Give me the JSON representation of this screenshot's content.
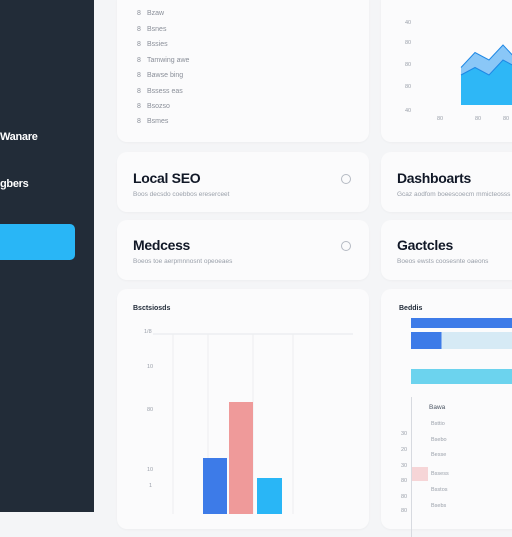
{
  "sidebar": {
    "items": [
      {
        "label": "Wanare"
      },
      {
        "label": "gbers"
      }
    ],
    "active_color": "#29b6f6"
  },
  "top_list": {
    "rows": [
      {
        "num": "8",
        "label": "Bzaw"
      },
      {
        "num": "8",
        "label": "Bsnes"
      },
      {
        "num": "8",
        "label": "Bssies"
      },
      {
        "num": "8",
        "label": "Tamwing awe"
      },
      {
        "num": "8",
        "label": "Bawse bing"
      },
      {
        "num": "8",
        "label": "Bssess eas"
      },
      {
        "num": "8",
        "label": "Bsozso"
      },
      {
        "num": "8",
        "label": "Bsmes"
      }
    ]
  },
  "area_chart": {
    "y_ticks": [
      "40",
      "80",
      "80",
      "80",
      "40"
    ],
    "x_ticks": [
      "80",
      "80",
      "80"
    ],
    "colors": {
      "back": "#64b5f6",
      "front": "#29b6f6",
      "edge": "#1e88e5"
    }
  },
  "tiles": [
    {
      "title": "Local SEO",
      "subtitle": "Boos decsdo coebbos ereserceet"
    },
    {
      "title": "Dashboarts",
      "subtitle": "Gcaz aodfom boeescoecm mmicteosss"
    },
    {
      "title": "Medcess",
      "subtitle": "Boeos toe aerpmnnosnt opeoeaes"
    },
    {
      "title": "Gactcles",
      "subtitle": "Boeos ewsts coosesnte oaeons"
    }
  ],
  "bar_chart": {
    "title": "Bsctsiosds",
    "y_ticks": [
      "1/8",
      "10",
      "80",
      "10",
      "1"
    ],
    "colors": {
      "blue": "#3d7be8",
      "pink": "#ef9a9a",
      "light": "#29b6f6"
    }
  },
  "hbar_chart": {
    "title": "Beddis",
    "colors": {
      "blue": "#3d7be8",
      "pale": "#d6eaf5",
      "cyan": "#6cd3ee"
    },
    "legend_title": "Bawa",
    "legend_items": [
      "Bsttio",
      "Bsebo",
      "Besse",
      "Bssess",
      "Bsstos",
      "Bsebs"
    ],
    "y_ticks": [
      "30",
      "20",
      "30",
      "80",
      "80",
      "80"
    ]
  },
  "chart_data": [
    {
      "type": "area",
      "series": [
        {
          "values": [
            5,
            7,
            6,
            8,
            6,
            7
          ]
        },
        {
          "values": [
            4,
            5,
            4,
            6,
            5,
            6
          ]
        }
      ]
    },
    {
      "type": "bar",
      "categories": [
        "",
        "",
        ""
      ],
      "values": [
        5.6,
        11.2,
        3.6
      ]
    },
    {
      "type": "bar",
      "categories": [
        "",
        "",
        ""
      ],
      "values": [
        100,
        75,
        100
      ]
    }
  ]
}
